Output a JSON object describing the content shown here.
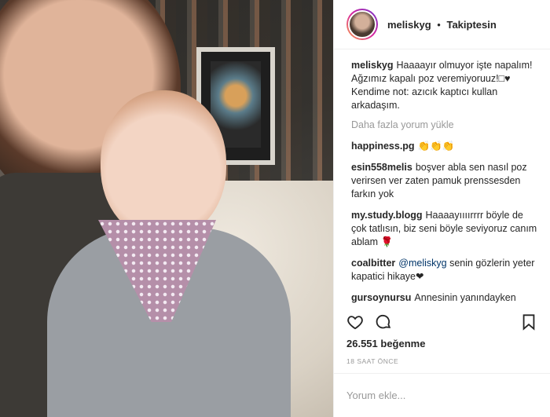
{
  "header": {
    "username": "meliskyg",
    "separator": "•",
    "follow_label": "Takiptesin"
  },
  "caption": {
    "username": "meliskyg",
    "text": "Haaaayır olmuyor işte napalım! Ağzımız kapalı poz veremiyoruuz!□♥ Kendime not: azıcık kaptıcı kullan arkadaşım."
  },
  "load_more": "Daha fazla yorum yükle",
  "comments": [
    {
      "username": "happiness.pg",
      "text": "👏👏👏"
    },
    {
      "username": "esin558melis",
      "text": "boşver abla sen nasıl poz verirsen ver zaten pamuk prenssesden farkın yok"
    },
    {
      "username": "my.study.blogg",
      "text": "Haaaayıııırrrr böyle de çok tatlısın, biz seni böyle seviyoruz canım ablam 🌹"
    },
    {
      "username": "coalbitter",
      "mention": "@meliskyg",
      "text": "senin gözlerin yeter kapatici hikaye❤"
    },
    {
      "username": "gursoynursu",
      "text": "Annesinin yanındayken annesine, babasının yanındayken babasına benzeyen çocuk yapmışsınız,tebrikler!!! 😍 👏👏👏"
    }
  ],
  "actions": {
    "like": "heart-icon",
    "comment": "comment-icon",
    "save": "bookmark-icon"
  },
  "likes_text": "26.551 beğenme",
  "timestamp": "18 SAAT ÖNCE",
  "add_comment_placeholder": "Yorum ekle..."
}
